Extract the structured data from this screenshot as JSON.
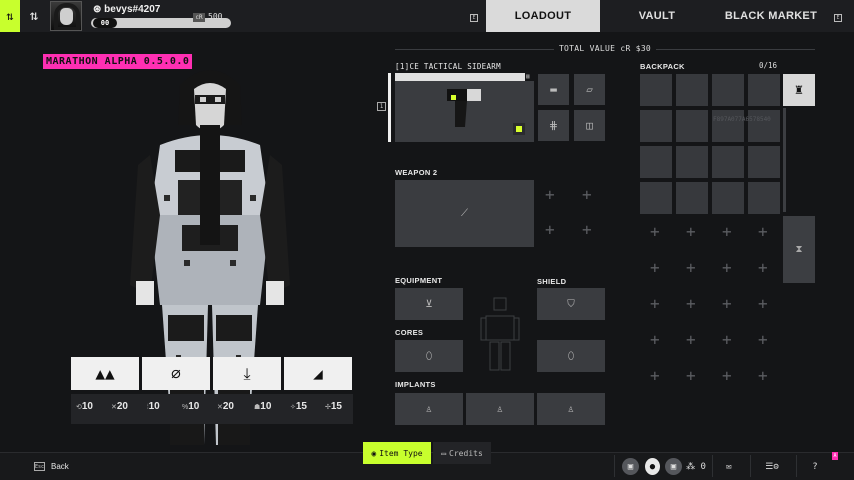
{
  "topbar": {
    "user_name": "bevys#4207",
    "user_tag": "",
    "level": "00",
    "currency_badge": "cR",
    "currency_value": "500",
    "key_left": "E",
    "key_right": "E",
    "tabs": [
      {
        "label": "LOADOUT",
        "active": true
      },
      {
        "label": "VAULT",
        "active": false
      },
      {
        "label": "BLACK MARKET",
        "active": false
      }
    ]
  },
  "build": {
    "version": "MARATHON ALPHA 0.5.0.0"
  },
  "abilities": {
    "icons": [
      "terrain-icon",
      "null-icon",
      "drop-icon",
      "stairs-icon"
    ],
    "stats": [
      {
        "icon": "⟲",
        "value": "10"
      },
      {
        "icon": "✕",
        "value": "20"
      },
      {
        "icon": "⦙",
        "value": "10"
      },
      {
        "icon": "%",
        "value": "10"
      },
      {
        "icon": "✕",
        "value": "20"
      },
      {
        "icon": "☗",
        "value": "10"
      },
      {
        "icon": "✧",
        "value": "15"
      },
      {
        "icon": "✢",
        "value": "15"
      }
    ]
  },
  "loadout": {
    "total_value_label": "TOTAL VALUE",
    "total_value_currency": "cR",
    "total_value_amount": "$30",
    "weapon1_label": "[1]CE TACTICAL SIDEARM",
    "slot_index": "1",
    "weapon2_label": "WEAPON 2",
    "equipment_label": "EQUIPMENT",
    "shield_label": "SHIELD",
    "cores_label": "CORES",
    "implants_label": "IMPLANTS"
  },
  "backpack": {
    "label": "BACKPACK",
    "capacity": "0/16",
    "watermark": "F897A077A6578540"
  },
  "bottombar": {
    "esc_key": "Esc",
    "back_label": "Back",
    "item_type_label": "Item Type",
    "credits_label": "Credits",
    "squad_count": "0",
    "help_label": "?",
    "notif": "A"
  },
  "colors": {
    "accent_lime": "#c8ff2d",
    "accent_pink": "#ff2fb3",
    "slot_bg": "#3a3c40"
  }
}
